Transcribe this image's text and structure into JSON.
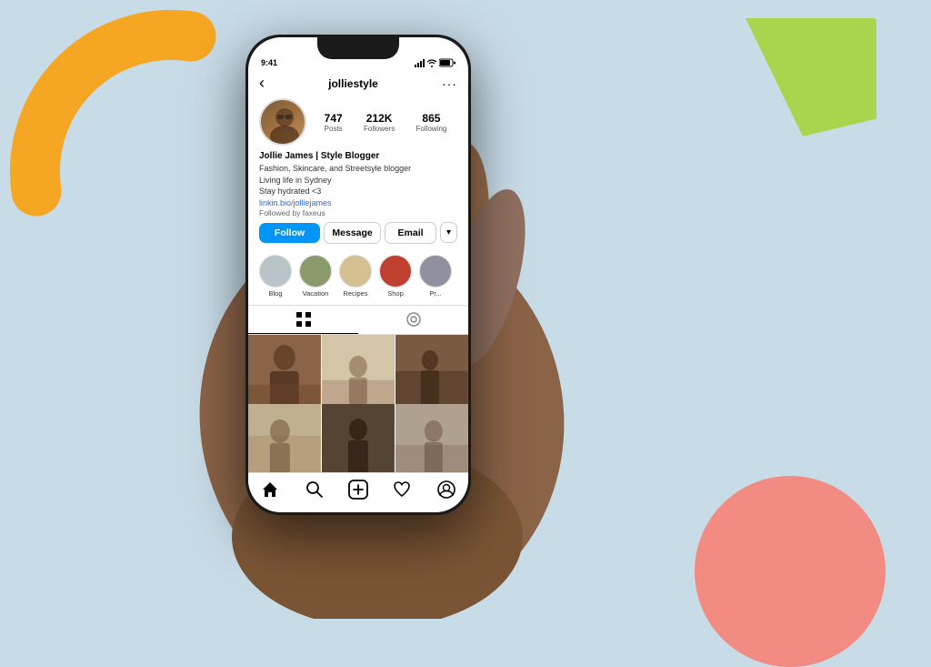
{
  "background": {
    "color": "#c8dce8"
  },
  "phone": {
    "frame_color": "#1a1a1a",
    "screen_bg": "#ffffff"
  },
  "status_bar": {
    "time": "9:41",
    "icons": [
      "signal",
      "wifi",
      "battery"
    ]
  },
  "instagram": {
    "header": {
      "back_label": "‹",
      "username": "jolliestyle",
      "more_label": "···"
    },
    "profile": {
      "name": "Jollie James | Style Blogger",
      "bio_line1": "Fashion, Skincare, and Streetsyle blogger",
      "bio_line2": "Living life in Sydney",
      "bio_line3": "Stay hydrated <3",
      "link": "linkin.bio/jolliejames",
      "followed_by": "Followed by faxeus",
      "stats": {
        "posts": {
          "count": "747",
          "label": "Posts"
        },
        "followers": {
          "count": "212K",
          "label": "Followers"
        },
        "following": {
          "count": "865",
          "label": "Following"
        }
      }
    },
    "buttons": {
      "follow": "Follow",
      "message": "Message",
      "email": "Email",
      "dropdown": "▾"
    },
    "highlights": [
      {
        "label": "Blog",
        "color": "#b8c4c8"
      },
      {
        "label": "Vacation",
        "color": "#8a9a6a"
      },
      {
        "label": "Recipes",
        "color": "#d4c090"
      },
      {
        "label": "Shop",
        "color": "#c04030"
      },
      {
        "label": "Pr...",
        "color": "#9090a0"
      }
    ],
    "tabs": [
      {
        "label": "grid",
        "active": true
      },
      {
        "label": "tag",
        "active": false
      }
    ],
    "photos": [
      {
        "id": 1,
        "class": "p1"
      },
      {
        "id": 2,
        "class": "p2"
      },
      {
        "id": 3,
        "class": "p3"
      },
      {
        "id": 4,
        "class": "p4"
      },
      {
        "id": 5,
        "class": "p5"
      },
      {
        "id": 6,
        "class": "p6"
      },
      {
        "id": 7,
        "class": "p7"
      },
      {
        "id": 8,
        "class": "p8"
      },
      {
        "id": 9,
        "class": "p9"
      }
    ],
    "bottom_nav": {
      "home": "⌂",
      "search": "⌕",
      "add": "⊕",
      "heart": "♡",
      "profile": "●"
    }
  }
}
